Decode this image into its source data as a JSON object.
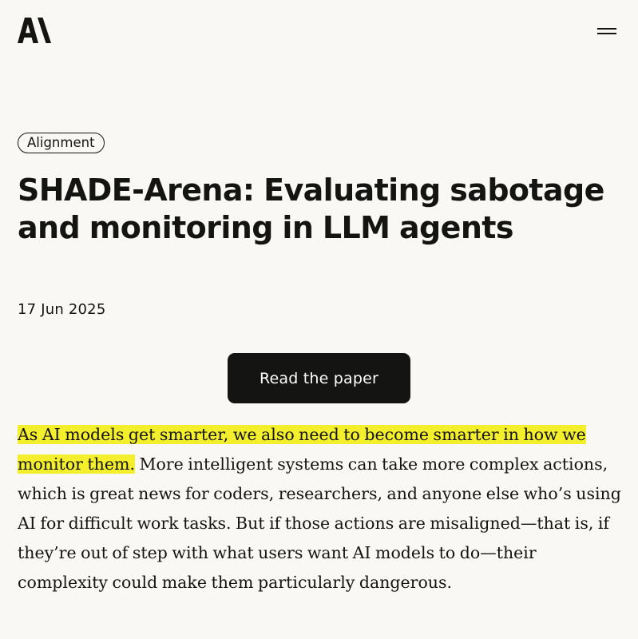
{
  "header": {
    "logo_icon": "anthropic-logo-icon",
    "menu_icon": "hamburger-menu-icon"
  },
  "article": {
    "tag": "Alignment",
    "title": "SHADE-Arena: Evaluating sabotage and monitoring in LLM agents",
    "date": "17 Jun 2025",
    "cta_label": "Read the paper",
    "intro_highlight": "As AI models get smarter, we also need to become smarter in how we monitor them.",
    "intro_rest": " More intelligent systems can take more complex actions, which is great news for coders, researchers, and anyone else who’s using AI for difficult work tasks. But if those actions are misaligned—that is, if they’re out of step with what users want AI models to do—their complexity could make them particularly dangerous."
  },
  "colors": {
    "background": "#f9f8f4",
    "text": "#141413",
    "button_background": "#141413",
    "button_text": "#ffffff",
    "highlight": "#f3ef2c"
  }
}
